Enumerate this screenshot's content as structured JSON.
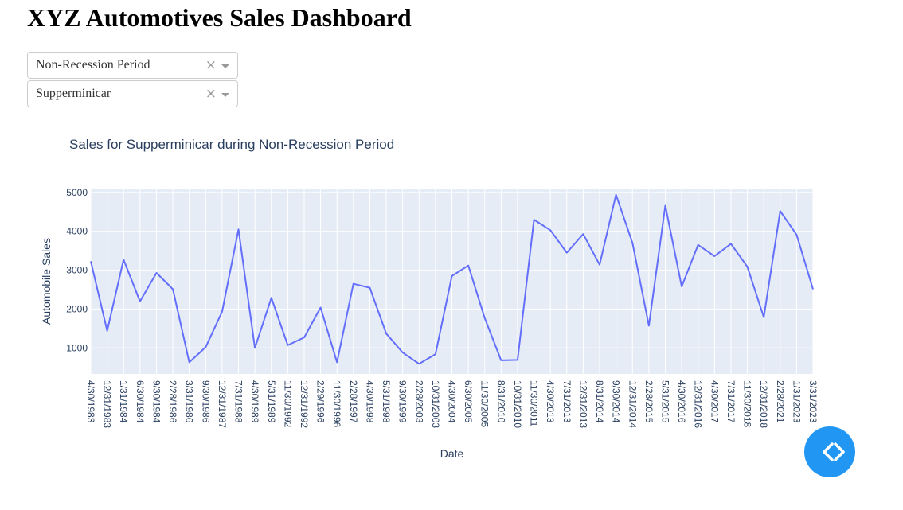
{
  "page": {
    "title": "XYZ Automotives Sales Dashboard"
  },
  "dropdowns": [
    {
      "value": "Non-Recession Period",
      "clear_icon": "×"
    },
    {
      "value": "Supperminicar",
      "clear_icon": "×"
    }
  ],
  "chart_data": {
    "type": "line",
    "title": "Sales for Supperminicar during Non-Recession Period",
    "xlabel": "Date",
    "ylabel": "Automobile Sales",
    "ylim": [
      330,
      5100
    ],
    "yticks": [
      1000,
      2000,
      3000,
      4000,
      5000
    ],
    "grid": true,
    "line_color": "#636efa",
    "plot_bg": "#e5ecf6",
    "x": [
      "4/30/1983",
      "12/31/1983",
      "1/31/1984",
      "6/30/1984",
      "9/30/1984",
      "2/28/1986",
      "3/31/1986",
      "9/30/1986",
      "12/31/1987",
      "7/31/1988",
      "4/30/1989",
      "5/31/1989",
      "11/30/1992",
      "12/31/1992",
      "2/29/1996",
      "11/30/1996",
      "2/28/1997",
      "4/30/1998",
      "5/31/1998",
      "9/30/1999",
      "2/28/2003",
      "10/31/2003",
      "4/30/2004",
      "6/30/2005",
      "11/30/2005",
      "8/31/2010",
      "10/31/2010",
      "11/30/2011",
      "4/30/2013",
      "7/31/2013",
      "12/31/2013",
      "8/31/2014",
      "9/30/2014",
      "12/31/2014",
      "2/28/2015",
      "5/31/2015",
      "4/30/2016",
      "12/31/2016",
      "4/30/2017",
      "7/31/2017",
      "11/30/2018",
      "12/31/2018",
      "2/28/2021",
      "1/31/2023",
      "3/31/2023"
    ],
    "values": [
      3230,
      1440,
      3270,
      2200,
      2930,
      2510,
      630,
      1020,
      1930,
      4050,
      1000,
      2290,
      1070,
      1270,
      2040,
      630,
      2650,
      2550,
      1370,
      880,
      590,
      840,
      2850,
      3120,
      1770,
      680,
      690,
      4300,
      4030,
      3450,
      3930,
      3140,
      4940,
      3700,
      1570,
      4660,
      2580,
      3650,
      3360,
      3680,
      3090,
      1790,
      4520,
      3910,
      2510
    ]
  },
  "fab": {
    "icon": "code-brackets-icon",
    "color": "#2196f3"
  }
}
